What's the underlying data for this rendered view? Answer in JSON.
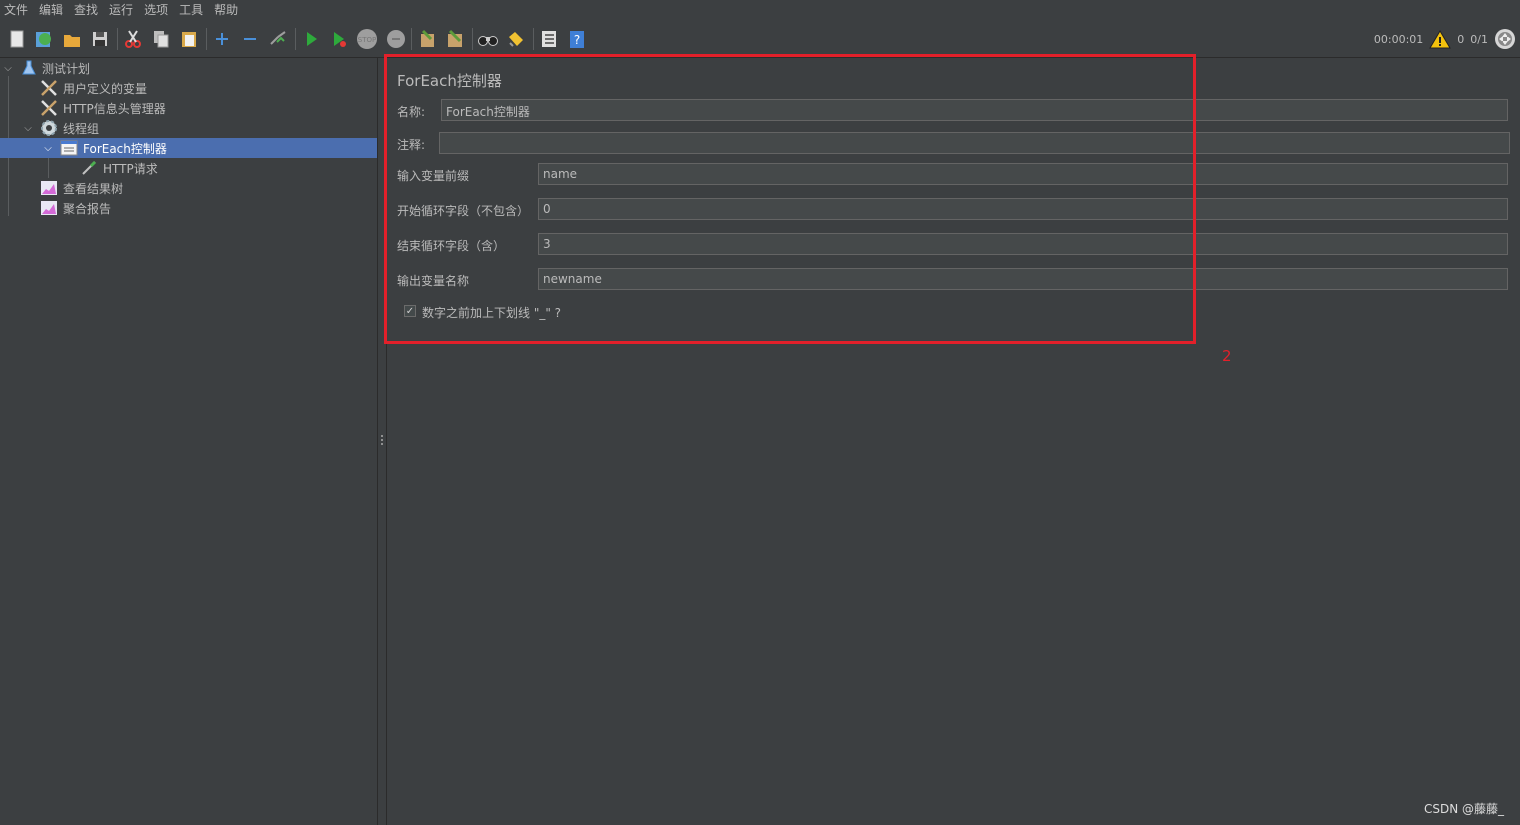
{
  "menu": [
    "文件",
    "编辑",
    "查找",
    "运行",
    "选项",
    "工具",
    "帮助"
  ],
  "toolbar": {
    "buttons": [
      {
        "name": "new-icon",
        "color": "#e8e8e8"
      },
      {
        "name": "templates-icon",
        "color": "#4caf50"
      },
      {
        "name": "open-icon",
        "color": "#e8a93b"
      },
      {
        "name": "save-icon",
        "color": "#d0d0d0"
      },
      {
        "name": "cut-icon",
        "color": "#e53935"
      },
      {
        "name": "copy-icon",
        "color": "#e0e0e0"
      },
      {
        "name": "paste-icon",
        "color": "#d9a94a"
      },
      {
        "name": "expand-icon",
        "color": "#4a90d9"
      },
      {
        "name": "collapse-icon",
        "color": "#4a90d9"
      },
      {
        "name": "toggle-icon",
        "color": "#9e9e9e"
      },
      {
        "name": "start-icon",
        "color": "#2eaa3c"
      },
      {
        "name": "start-no-pauses-icon",
        "color": "#2eaa3c"
      },
      {
        "name": "stop-icon",
        "color": "#9e9e9e"
      },
      {
        "name": "shutdown-icon",
        "color": "#9e9e9e"
      },
      {
        "name": "clear-icon",
        "color": "#c8a26b"
      },
      {
        "name": "clear-all-icon",
        "color": "#c8a26b"
      },
      {
        "name": "search-icon",
        "color": "#d0d0d0"
      },
      {
        "name": "reset-search-icon",
        "color": "#f1c232"
      },
      {
        "name": "function-helper-icon",
        "color": "#e0e0e0"
      },
      {
        "name": "help-icon",
        "color": "#3f7fd6"
      }
    ],
    "timer": "00:00:01",
    "warning_count": "0",
    "threads": "0/1"
  },
  "tree": {
    "items": [
      {
        "label": "测试计划",
        "icon": "flask-icon"
      },
      {
        "label": "用户定义的变量",
        "icon": "wrench-icon"
      },
      {
        "label": "HTTP信息头管理器",
        "icon": "wrench-icon"
      },
      {
        "label": "线程组",
        "icon": "gear-icon"
      },
      {
        "label": "ForEach控制器",
        "icon": "controller-icon"
      },
      {
        "label": "HTTP请求",
        "icon": "pipette-icon"
      },
      {
        "label": "查看结果树",
        "icon": "chart-icon"
      },
      {
        "label": "聚合报告",
        "icon": "chart-icon"
      }
    ]
  },
  "panel": {
    "title": "ForEach控制器",
    "name_label": "名称:",
    "name_value": "ForEach控制器",
    "comment_label": "注释:",
    "comment_value": "",
    "fields": [
      {
        "label": "输入变量前缀",
        "value": "name"
      },
      {
        "label": "开始循环字段（不包含）",
        "value": "0"
      },
      {
        "label": "结束循环字段（含）",
        "value": "3"
      },
      {
        "label": "输出变量名称",
        "value": "newname"
      }
    ],
    "checkbox_label": "数字之前加上下划线 \"_\" ?",
    "checkbox_checked": true
  },
  "annotation": "2",
  "watermark": "CSDN @藤藤_",
  "colors": {
    "highlight": "#e3202a",
    "selection": "#4b6eaf"
  }
}
